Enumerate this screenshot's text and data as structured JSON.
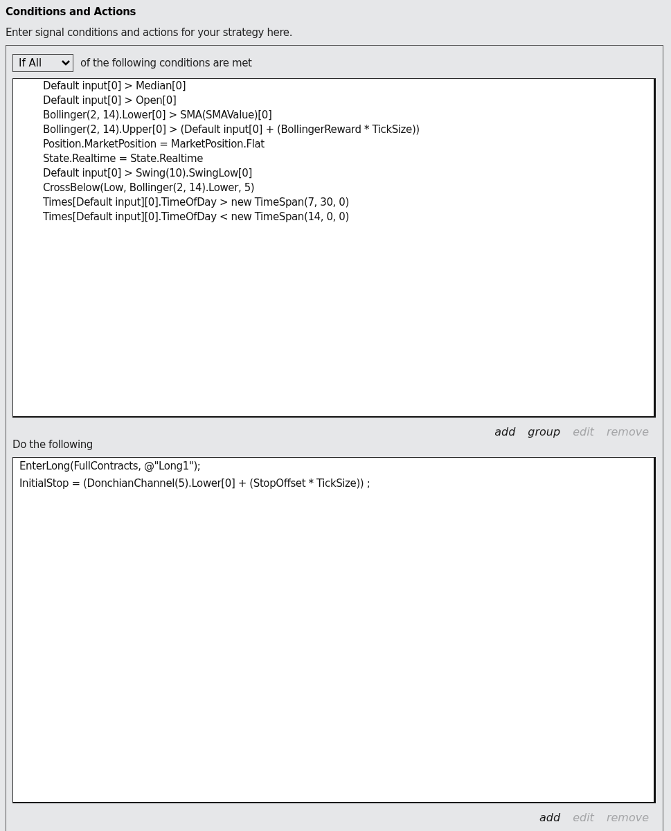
{
  "header": {
    "title": "Conditions and Actions",
    "description": "Enter signal conditions and actions for your strategy here."
  },
  "conditions": {
    "match_select": {
      "value": "If All"
    },
    "match_label": "of the following conditions are met",
    "items": [
      "Default input[0] > Median[0]",
      "Default input[0] > Open[0]",
      "Bollinger(2, 14).Lower[0] > SMA(SMAValue)[0]",
      "Bollinger(2, 14).Upper[0] > (Default input[0] + (BollingerReward * TickSize))",
      "Position.MarketPosition = MarketPosition.Flat",
      "State.Realtime = State.Realtime",
      "Default input[0] > Swing(10).SwingLow[0]",
      "CrossBelow(Low, Bollinger(2, 14).Lower, 5)",
      "Times[Default input][0].TimeOfDay > new TimeSpan(7, 30, 0)",
      "Times[Default input][0].TimeOfDay < new TimeSpan(14, 0, 0)"
    ],
    "links": [
      {
        "label": "add",
        "disabled": false
      },
      {
        "label": "group",
        "disabled": false
      },
      {
        "label": "edit",
        "disabled": true
      },
      {
        "label": "remove",
        "disabled": true
      }
    ]
  },
  "actions": {
    "title": "Do the following",
    "items": [
      "EnterLong(FullContracts, @\"Long1\");",
      "InitialStop = (DonchianChannel(5).Lower[0] + (StopOffset * TickSize)) ;"
    ],
    "links": [
      {
        "label": "add",
        "disabled": false
      },
      {
        "label": "edit",
        "disabled": true
      },
      {
        "label": "remove",
        "disabled": true
      }
    ]
  }
}
